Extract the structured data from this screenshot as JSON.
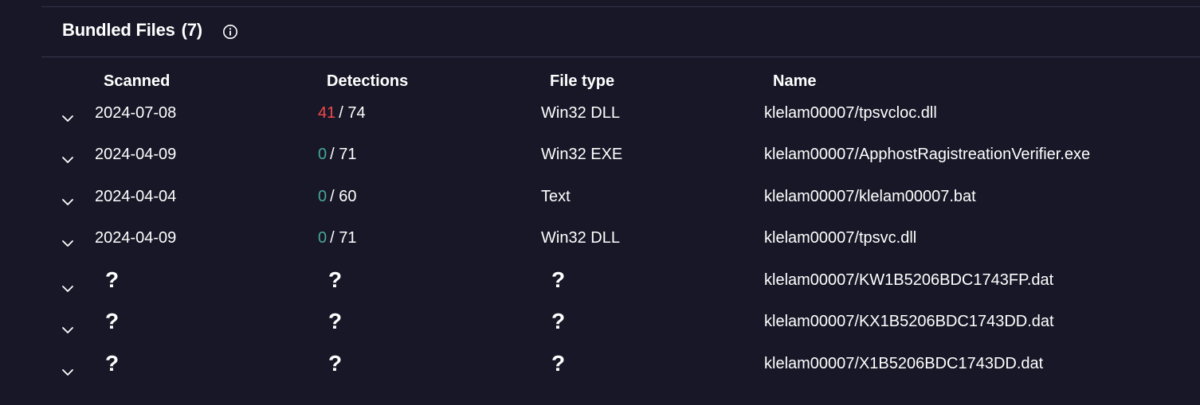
{
  "section": {
    "title": "Bundled Files",
    "count": "(7)",
    "info_icon": "info-circle-icon"
  },
  "columns": {
    "scanned": "Scanned",
    "detections": "Detections",
    "file_type": "File type",
    "name": "Name"
  },
  "colors": {
    "background": "#181727",
    "detections_positive": "#f14a4a",
    "detections_zero": "#46a89a",
    "text": "#ffffff"
  },
  "rows": [
    {
      "scanned": "2024-07-08",
      "det_count": "41",
      "det_total": "/ 74",
      "det_positive": true,
      "file_type": "Win32 DLL",
      "name": "klelam00007/tpsvcloc.dll"
    },
    {
      "scanned": "2024-04-09",
      "det_count": "0",
      "det_total": "/ 71",
      "det_positive": false,
      "file_type": "Win32 EXE",
      "name": "klelam00007/ApphostRagistreationVerifier.exe"
    },
    {
      "scanned": "2024-04-04",
      "det_count": "0",
      "det_total": "/ 60",
      "det_positive": false,
      "file_type": "Text",
      "name": "klelam00007/klelam00007.bat"
    },
    {
      "scanned": "2024-04-09",
      "det_count": "0",
      "det_total": "/ 71",
      "det_positive": false,
      "file_type": "Win32 DLL",
      "name": "klelam00007/tpsvc.dll"
    },
    {
      "scanned": "?",
      "det_unknown": "?",
      "file_type": "?",
      "name": "klelam00007/KW1B5206BDC1743FP.dat"
    },
    {
      "scanned": "?",
      "det_unknown": "?",
      "file_type": "?",
      "name": "klelam00007/KX1B5206BDC1743DD.dat"
    },
    {
      "scanned": "?",
      "det_unknown": "?",
      "file_type": "?",
      "name": "klelam00007/X1B5206BDC1743DD.dat"
    }
  ]
}
